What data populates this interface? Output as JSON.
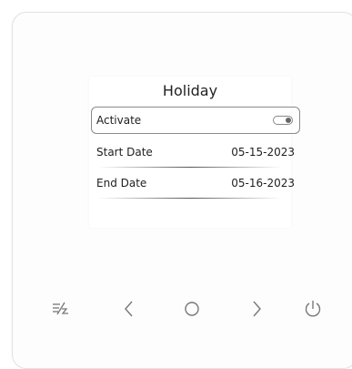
{
  "screen": {
    "title": "Holiday",
    "activate": {
      "label": "Activate",
      "enabled": true
    },
    "start_date": {
      "label": "Start Date",
      "value": "05-15-2023"
    },
    "end_date": {
      "label": "End Date",
      "value": "05-16-2023"
    }
  },
  "buttons": [
    {
      "name": "menu-toggle-button",
      "icon": "lines-slash-icon"
    },
    {
      "name": "previous-button",
      "icon": "chevron-left-icon"
    },
    {
      "name": "home-button",
      "icon": "circle-icon"
    },
    {
      "name": "next-button",
      "icon": "chevron-right-icon"
    },
    {
      "name": "power-button",
      "icon": "power-icon"
    }
  ],
  "colors": {
    "icon": "#777777",
    "text": "#1e1e1e",
    "border": "#8a8a8a"
  }
}
